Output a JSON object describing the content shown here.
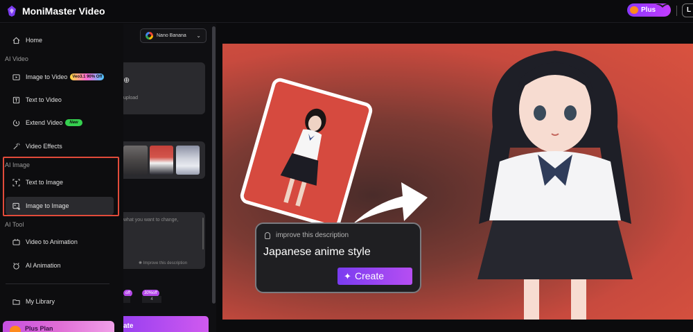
{
  "header": {
    "app_title": "MoniMaster Video",
    "plus_label": "Plus",
    "login_label": "L"
  },
  "sidebar": {
    "home": "Home",
    "section_ai_video": "AI Video",
    "image_to_video": "Image to Video",
    "image_to_video_badge": "Veo3.1 90% Off",
    "text_to_video": "Text to Video",
    "extend_video": "Extend Video",
    "extend_video_badge": "New",
    "video_effects": "Video Effects",
    "section_ai_image": "AI Image",
    "text_to_image": "Text to Image",
    "image_to_image": "Image to Image",
    "section_ai_tool": "AI Tool",
    "video_to_animation": "Video to Animation",
    "ai_animation": "AI Animation",
    "my_library": "My Library",
    "plus_plan": "Plus Plan"
  },
  "panel": {
    "model_name": "Nano Banana",
    "upload_text": "upload",
    "prompt_placeholder": "what you want to change,",
    "improve_label": "Improve this description",
    "off_badge_1": "off",
    "off_badge_2": "30%off",
    "ratio_label": "4",
    "create_label": "ate"
  },
  "banner": {
    "hint": "improve this description",
    "style_text": "Japanese anime style",
    "create_label": "Create"
  },
  "colors": {
    "accent": "#9a40f0",
    "highlight": "#e24b3a",
    "banner_bg": "#d9523f"
  }
}
